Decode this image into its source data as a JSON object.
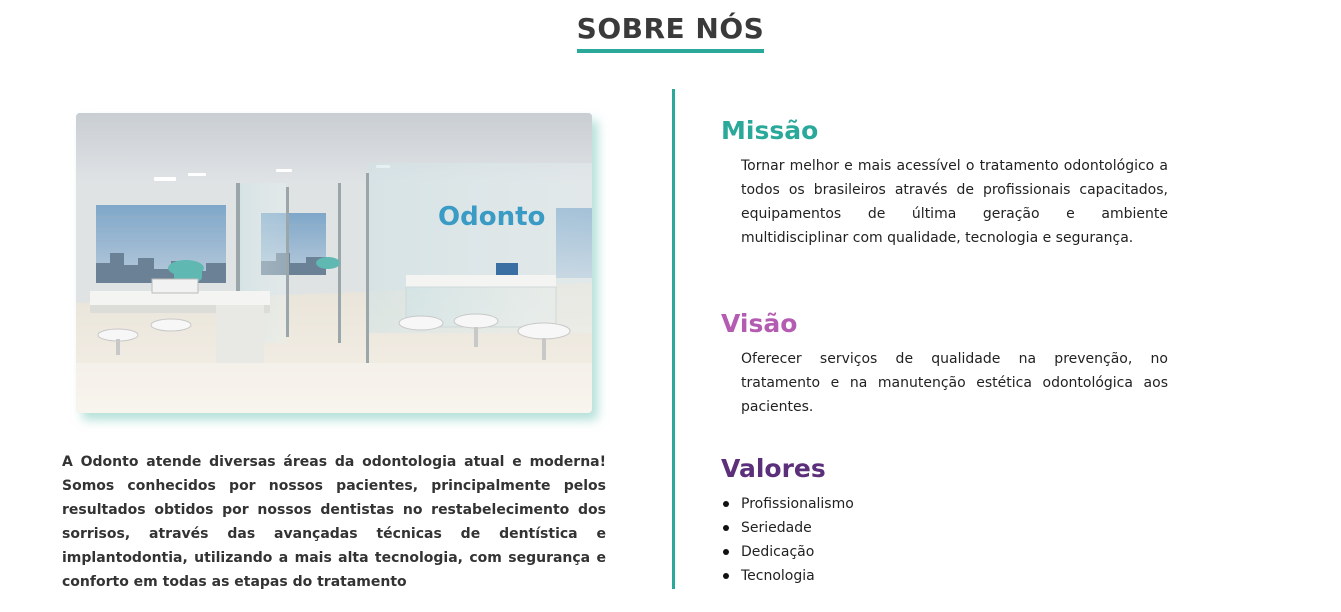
{
  "header": {
    "title": "SOBRE NÓS"
  },
  "about": {
    "photo_sign": "Odonto",
    "text": "A Odonto atende diversas áreas da odontologia atual e moderna! Somos conhecidos por nossos pacientes, principalmente pelos resultados obtidos por nossos dentistas no restabelecimento dos sorrisos, através das avançadas técnicas de dentística e implantodontia, utilizando a mais alta tecnologia, com segurança e conforto em todas as etapas do tratamento"
  },
  "missao": {
    "title": "Missão",
    "text": "Tornar melhor e mais acessível o tratamento odontológico a todos os brasileiros através de profissionais capacitados, equipamentos de última geração e ambiente multidisciplinar com qualidade, tecnologia e segurança."
  },
  "visao": {
    "title": "Visão",
    "text": "Oferecer serviços de qualidade na prevenção, no tratamento e na manutenção estética odontológica aos pacientes."
  },
  "valores": {
    "title": "Valores",
    "items": [
      "Profissionalismo",
      "Seriedade",
      "Dedicação",
      "Tecnologia"
    ]
  },
  "colors": {
    "accent_teal": "#2aa99b",
    "visao_pink": "#b45cb2",
    "valores_purple": "#5c2f7a"
  }
}
